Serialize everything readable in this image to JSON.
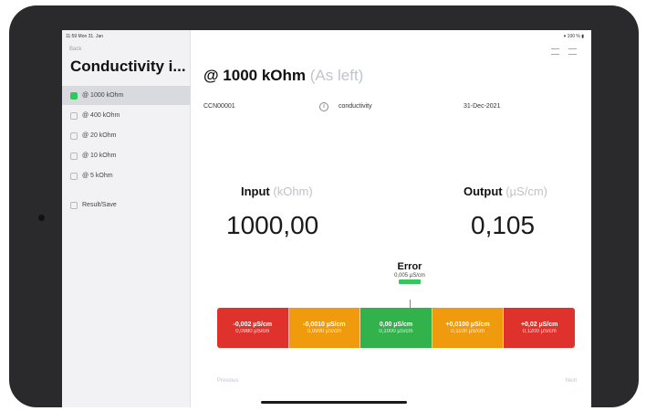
{
  "status": {
    "time": "11:59 Mon 31. Jan",
    "right": "▾ 100 % ▮"
  },
  "sidebar": {
    "back_label": "Back",
    "title": "Conductivity i...",
    "items": [
      {
        "label": "@ 1000 kOhm",
        "active": true
      },
      {
        "label": "@ 400 kOhm",
        "active": false
      },
      {
        "label": "@ 20 kOhm",
        "active": false
      },
      {
        "label": "@ 10 kOhm",
        "active": false
      },
      {
        "label": "@ 5 kOhm",
        "active": false
      },
      {
        "label": "Result/Save",
        "active": false
      }
    ]
  },
  "header": {
    "title": "@ 1000 kOhm",
    "title_suffix": "(As left)"
  },
  "meta": {
    "id_value": "CCN00001",
    "type_value": "conductivity",
    "date_value": "31-Dec-2021"
  },
  "input": {
    "label": "Input",
    "unit": "(kOhm)",
    "value": "1000,00"
  },
  "output": {
    "label": "Output",
    "unit": "(µS/cm)",
    "value": "0,105"
  },
  "error": {
    "title": "Error",
    "value": "0,005 µS/cm"
  },
  "scale": {
    "segments": [
      {
        "main": "-0,002 µS/cm",
        "sub": "0,0980 µS/cm",
        "color": "#e0322c"
      },
      {
        "main": "-0,0010 µS/cm",
        "sub": "0,0990 µS/cm",
        "color": "#f09a0d"
      },
      {
        "main": "0,00 µS/cm",
        "sub": "0,1000 µS/cm",
        "color": "#32b24a"
      },
      {
        "main": "+0,0100 µS/cm",
        "sub": "0,1100 µS/cm",
        "color": "#f09a0d"
      },
      {
        "main": "+0,02 µS/cm",
        "sub": "0,1200 µS/cm",
        "color": "#e0322c"
      }
    ]
  },
  "footer": {
    "previous_label": "Previous",
    "next_label": "Next"
  },
  "colors": {
    "accent_green": "#34c759",
    "red": "#e0322c",
    "orange": "#f09a0d",
    "green": "#32b24a"
  }
}
